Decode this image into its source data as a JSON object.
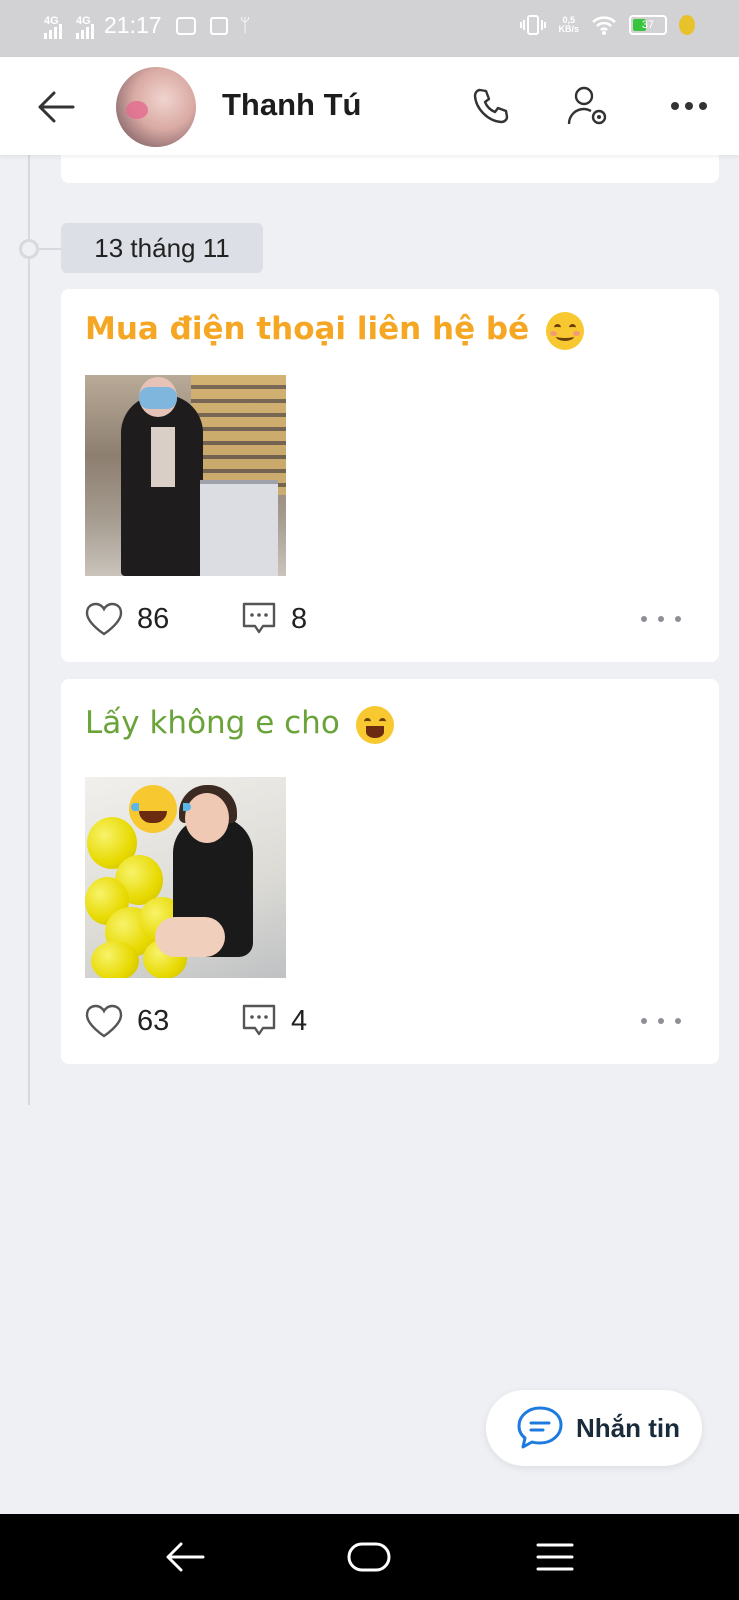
{
  "status_bar": {
    "signal1": "4G",
    "signal2": "4G",
    "time": "21:17",
    "net_speed_value": "0,5",
    "net_speed_unit": "KB/s",
    "battery": "37",
    "battery_level": 0.37,
    "icons": [
      "zalo-icon",
      "sim-icon",
      "usb-icon",
      "vibrate-icon",
      "wifi-icon",
      "battery-icon",
      "charging-icon"
    ]
  },
  "header": {
    "contact_name": "Thanh Tú",
    "icons": [
      "back-arrow-icon",
      "phone-icon",
      "user-settings-icon",
      "more-dots-icon"
    ]
  },
  "timeline": {
    "date_label": "13 tháng 11",
    "posts": [
      {
        "caption": "Mua điện thoại liên hệ bé",
        "caption_color": "#f5a623",
        "emoji": "smiling-face-icon",
        "likes": "86",
        "comments": "8"
      },
      {
        "caption": "Lấy không e cho",
        "caption_color": "#6aa33a",
        "emoji": "tears-of-joy-icon",
        "likes": "63",
        "comments": "4"
      }
    ]
  },
  "message_button": {
    "label": "Nhắn tin",
    "icon": "chat-bubble-icon",
    "accent": "#1d7be0"
  },
  "nav_bar": {
    "icons": [
      "nav-back-icon",
      "nav-home-icon",
      "nav-menu-icon"
    ]
  }
}
